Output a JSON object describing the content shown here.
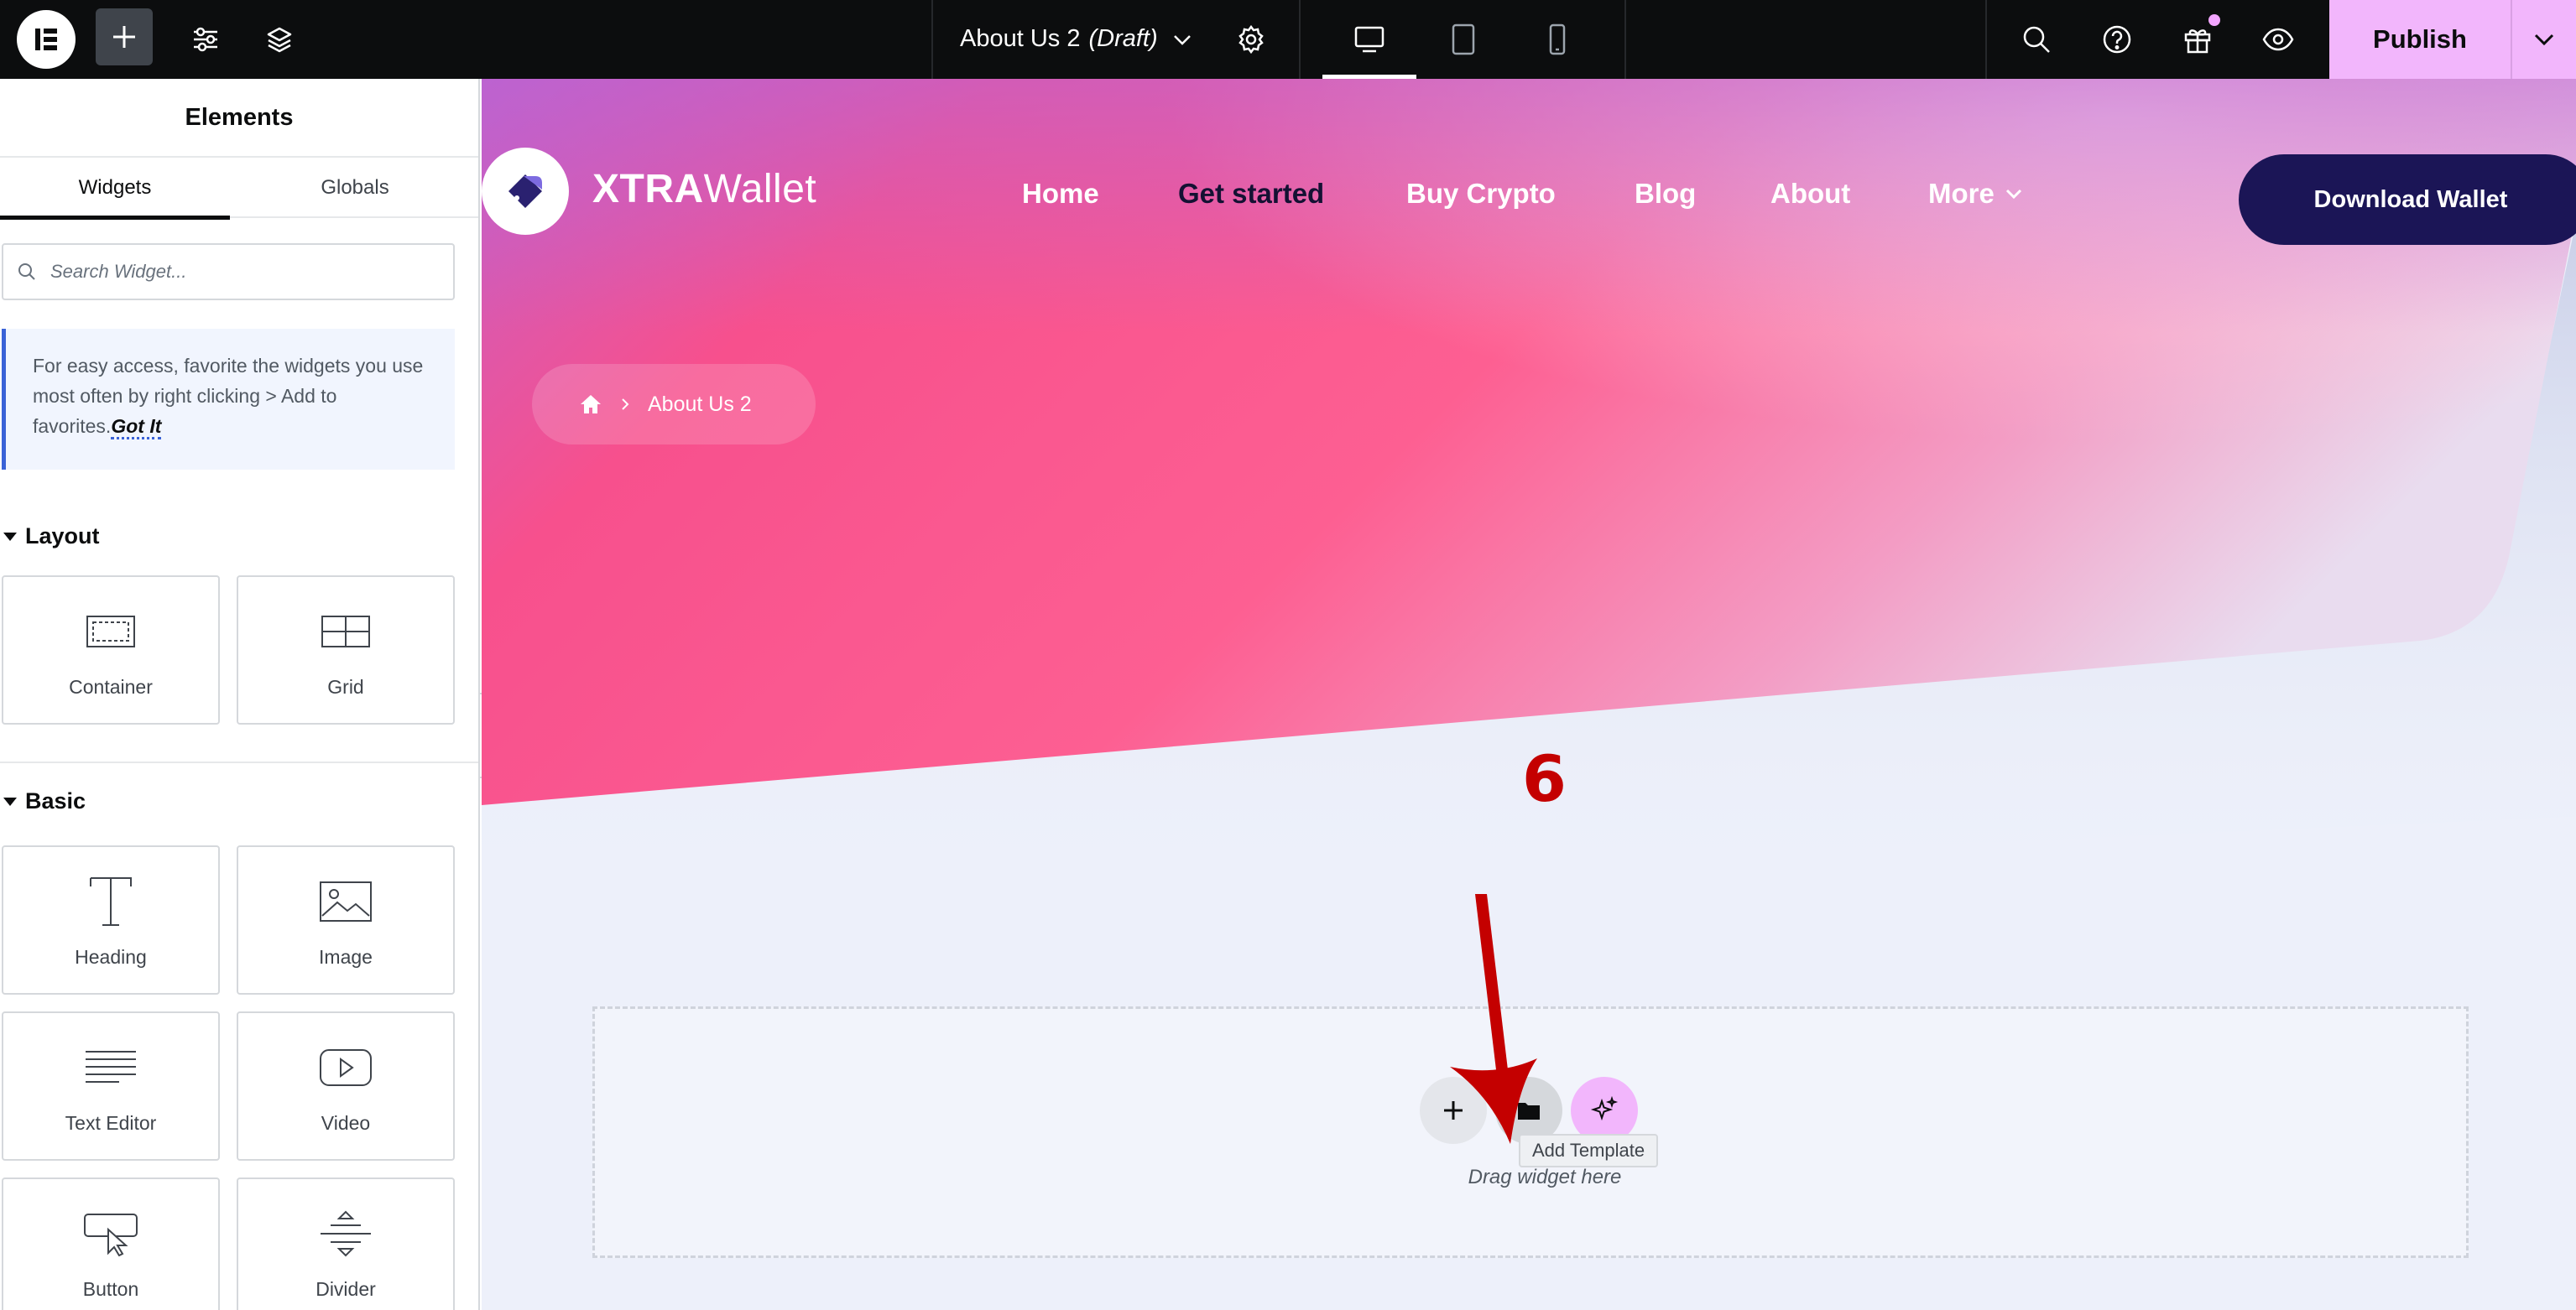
{
  "topbar": {
    "doc_title": "About Us 2",
    "doc_status": "(Draft)",
    "publish_label": "Publish"
  },
  "panel": {
    "title": "Elements",
    "tabs": [
      "Widgets",
      "Globals"
    ],
    "search_placeholder": "Search Widget...",
    "tip_text": "For easy access, favorite the widgets you use most often by right clicking > Add to favorites.",
    "tip_link": "Got It",
    "sections": [
      {
        "name": "Layout",
        "widgets": [
          {
            "label": "Container",
            "icon": "container-icon"
          },
          {
            "label": "Grid",
            "icon": "grid-icon"
          }
        ]
      },
      {
        "name": "Basic",
        "widgets": [
          {
            "label": "Heading",
            "icon": "heading-icon"
          },
          {
            "label": "Image",
            "icon": "image-icon"
          },
          {
            "label": "Text Editor",
            "icon": "text-editor-icon"
          },
          {
            "label": "Video",
            "icon": "video-icon"
          },
          {
            "label": "Button",
            "icon": "button-icon"
          },
          {
            "label": "Divider",
            "icon": "divider-icon"
          }
        ]
      }
    ]
  },
  "site": {
    "brand_bold": "XTRA",
    "brand_light": "Wallet",
    "nav": [
      "Home",
      "Get started",
      "Buy Crypto",
      "Blog",
      "About",
      "More"
    ],
    "active_nav": "Get started",
    "cta_label": "Download Wallet",
    "breadcrumb_current": "About Us 2"
  },
  "editor": {
    "tooltip": "Add Template",
    "dropzone_text": "Drag widget here",
    "annotation_number": "6"
  },
  "colors": {
    "topbar_bg": "#0c0d0e",
    "publish_bg": "#f2b6fc",
    "hero_pink": "#fd4f86",
    "cta_bg": "#1b1556",
    "annotation_red": "#c40000"
  }
}
